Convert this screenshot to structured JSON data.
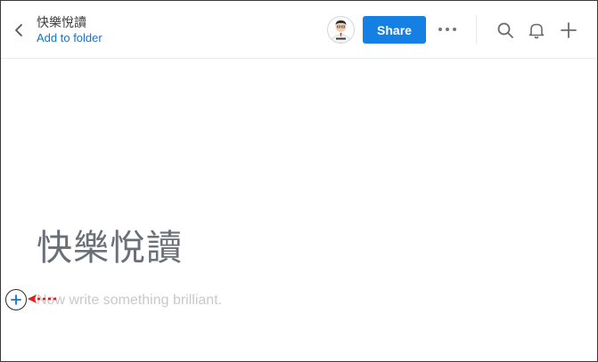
{
  "header": {
    "title": "快樂悅讀",
    "add_to_folder": "Add to folder",
    "share_label": "Share"
  },
  "editor": {
    "heading": "快樂悅讀",
    "placeholder": "Now write something brilliant."
  },
  "colors": {
    "accent": "#1480e3",
    "link": "#1a73c9",
    "annotation_arrow": "#e41c1c"
  },
  "icons": [
    "back-chevron-icon",
    "avatar",
    "more-icon",
    "search-icon",
    "bell-icon",
    "plus-icon",
    "add-block-icon",
    "annotation-arrow"
  ]
}
